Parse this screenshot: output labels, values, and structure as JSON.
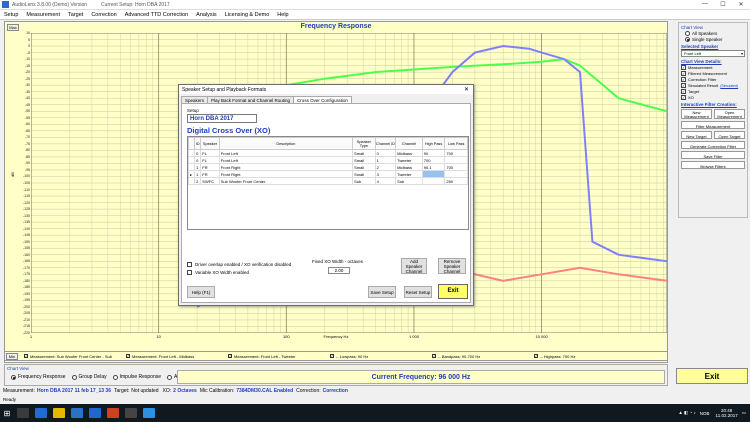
{
  "window": {
    "app_name": "AudioLens 3.8.00 (Demo) Version",
    "setup_label": "Current Setup: Horn DBA 2017"
  },
  "menu": [
    "Setup",
    "Measurement",
    "Target",
    "Correction",
    "Advanced TTD Correction",
    "Analysis",
    "Licensing & Demo",
    "Help"
  ],
  "plot": {
    "title": "Frequency Response",
    "max_btn": "Max",
    "min_btn": "Min",
    "ylabel": "dB",
    "xlabel": "Frequency Hz",
    "yticks": [
      "10",
      "5",
      "0",
      "-5",
      "-10",
      "-15",
      "-20",
      "-25",
      "-30",
      "-35",
      "-40",
      "-45",
      "-50",
      "-55",
      "-60",
      "-65",
      "-70",
      "-75",
      "-80",
      "-85",
      "-90",
      "-95",
      "-100",
      "-105",
      "-110",
      "-115",
      "-120",
      "-125",
      "-130",
      "-135",
      "-140",
      "-145",
      "-150",
      "-155",
      "-160",
      "-165",
      "-170",
      "-175",
      "-180",
      "-185",
      "-190",
      "-195",
      "-200",
      "-205",
      "-210",
      "-215",
      "-220"
    ],
    "xticks": [
      "1",
      "10",
      "100",
      "1 000",
      "10 000"
    ]
  },
  "chart_data": {
    "type": "line",
    "xlabel": "Frequency Hz",
    "ylabel": "dB",
    "xscale": "log",
    "xlim": [
      1,
      96000
    ],
    "ylim": [
      -220,
      10
    ],
    "series": [
      {
        "name": "Measurement: Front Left - Midbass",
        "color": "#4cff4c",
        "x": [
          20,
          50,
          100,
          200,
          500,
          1000,
          2000,
          5000,
          10000,
          15000,
          20000,
          40000,
          96000
        ],
        "y": [
          -60,
          -40,
          -30,
          -25,
          -20,
          -18,
          -16,
          -14,
          -12,
          -10,
          -15,
          -40,
          -50
        ]
      },
      {
        "name": "Measurement: Front Left - Tweeter",
        "color": "#8080ff",
        "x": [
          20,
          100,
          500,
          1000,
          2000,
          3000,
          5000,
          8000,
          10000,
          15000,
          20000,
          25000,
          40000,
          96000
        ],
        "y": [
          -200,
          -160,
          -100,
          -60,
          -20,
          -5,
          0,
          -2,
          -5,
          -10,
          -20,
          -150,
          -160,
          -165
        ]
      },
      {
        "name": "Measurement: Sub Woofer Front Center",
        "color": "#ff8080",
        "x": [
          20,
          50,
          100,
          200,
          300,
          500,
          1000,
          3000,
          5000,
          10000,
          20000,
          40000,
          96000
        ],
        "y": [
          -60,
          -50,
          -55,
          -90,
          -130,
          -160,
          -170,
          -175,
          -180,
          -175,
          -170,
          -175,
          -180
        ]
      }
    ]
  },
  "legend": [
    "Measurement: Sub Woofer Front Center - Sub",
    "Measurement: Front Left - Midbass",
    "Measurement: Front Left - Tweeter",
    "-- Lowpass: 90 Hz",
    "-- Bandpass: 90-700 Hz",
    "-- Highpass: 700 Hz"
  ],
  "right_panel": {
    "chart_view_label": "Chart View",
    "all_speakers": "All Speakers",
    "single_speaker": "Single Speaker",
    "selected_speaker_label": "Selected Speaker",
    "selected_speaker": "Front Left",
    "details_label": "Chart View Details:",
    "checks": [
      "Measurement",
      "Filtered Measurement",
      "Correction Filter",
      "Simulated Result",
      "Target",
      "XO"
    ],
    "simulated_link": "(Simulated)",
    "filter_creation_label": "Interactive Filter Creation:",
    "new_measurement": "New Measurement",
    "open_measurement": "Open Measurement",
    "filter_measurement": "Filter Measurement",
    "new_target": "New Target",
    "open_target": "Open Target",
    "generate_filter": "Generate Correction Filter",
    "save_filter": "Save Filter",
    "browse_filters": "Browse Filters"
  },
  "bottom": {
    "chart_view": "Chart View",
    "radios": [
      "Frequency Response",
      "Group Delay",
      "Impulse Response",
      "All"
    ],
    "current_freq": "Current Frequency: 96 000 Hz",
    "exit": "Exit"
  },
  "dialog": {
    "title": "Speaker Setup and Playback Formats",
    "tabs": [
      "Speakers",
      "Play Back Format and Channel Routing",
      "Cross Over Configuration"
    ],
    "setup_label": "Setup",
    "setup_name": "Horn DBA 2017",
    "xo_title": "Digital Cross Over (XO)",
    "columns": [
      "",
      "ID",
      "Speaker",
      "Description",
      "Speaker Type",
      "Channel ID",
      "Channel",
      "High Pass",
      "Low Pass"
    ],
    "rows": [
      [
        "",
        "0",
        "FL",
        "Front Left",
        "Small",
        "0",
        "Midbass",
        "90",
        "700"
      ],
      [
        "",
        "0",
        "FL",
        "Front Left",
        "Small",
        "1",
        "Tweeter",
        "700",
        ""
      ],
      [
        "",
        "1",
        "FR",
        "Front Right",
        "Small",
        "2",
        "Midbass",
        "90,1",
        "700"
      ],
      [
        "▸",
        "1",
        "FR",
        "Front Right",
        "Small",
        "3",
        "Tweeter",
        "",
        ""
      ],
      [
        "",
        "2",
        "SWFC",
        "Sub Woofer Front Center",
        "Sub",
        "4",
        "Sub",
        "",
        "250"
      ]
    ],
    "opt1": "Driver overlap enabled / XO verification disabled",
    "opt2": "Variable XO Width enabled",
    "xo_width_label": "Fixed XO Width - octaves",
    "xo_width": "2.00",
    "add_channel": "Add Speaker Channel",
    "remove_channel": "Remove Speaker Channel",
    "help": "Help (F1)",
    "save_setup": "Save Setup",
    "reset_setup": "Reset Setup",
    "exit": "Exit"
  },
  "status": {
    "measurement_label": "Measurement:",
    "measurement": "Horn DBA 2017 11 feb 17_13 36",
    "target_label": "Target:",
    "target": "Not updated",
    "xo_label": "XO:",
    "xo": "2 Octaves",
    "mic_label": "Mic Calibration:",
    "mic": "7384DM30.CAL Enabled",
    "correction_label": "Correction:",
    "correction": "Correction",
    "ready": "Ready"
  },
  "taskbar": {
    "lang": "NOB",
    "time": "20:48",
    "date": "11.02.2017"
  }
}
